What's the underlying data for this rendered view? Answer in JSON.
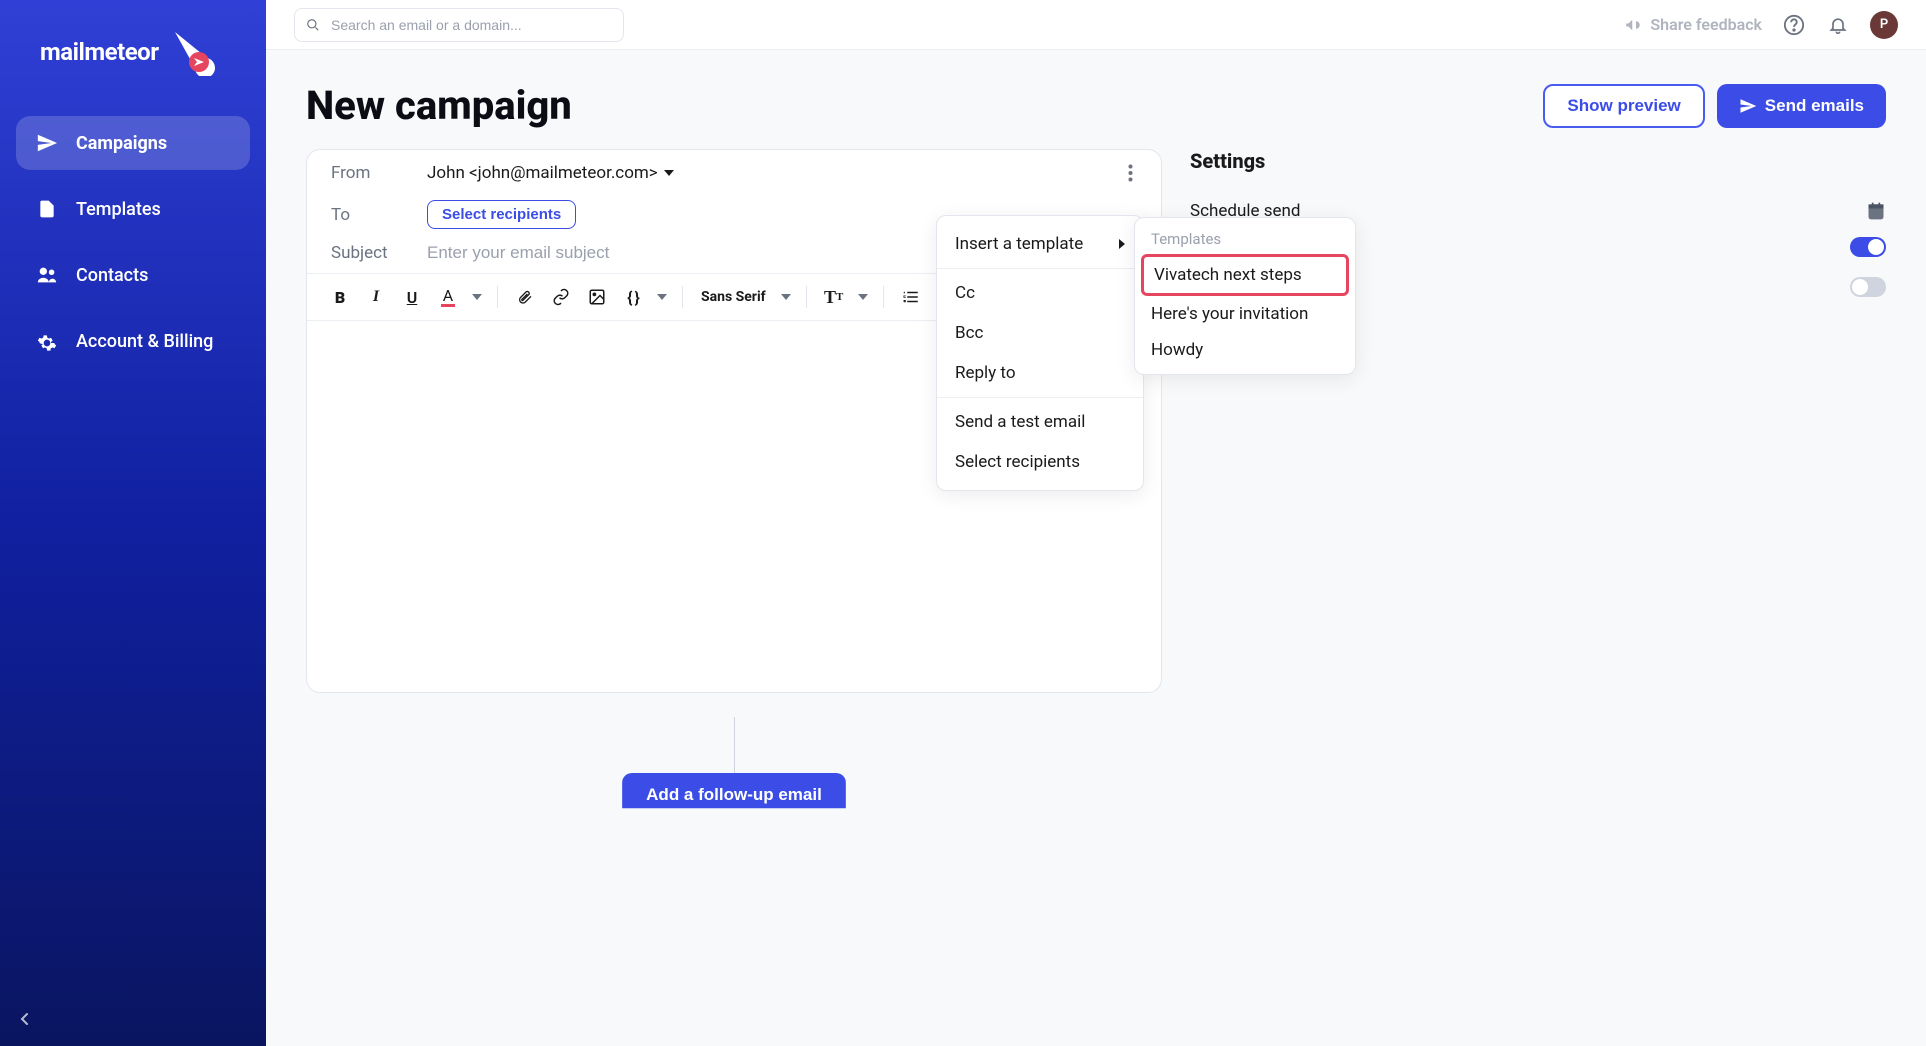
{
  "brand": {
    "name": "mailmeteor"
  },
  "sidebar": {
    "items": [
      {
        "label": "Campaigns",
        "icon": "send"
      },
      {
        "label": "Templates",
        "icon": "file"
      },
      {
        "label": "Contacts",
        "icon": "people"
      },
      {
        "label": "Account & Billing",
        "icon": "gear"
      }
    ]
  },
  "topbar": {
    "search_placeholder": "Search an email or a domain...",
    "feedback_label": "Share feedback",
    "avatar_initial": "P"
  },
  "page": {
    "title": "New campaign",
    "show_preview_label": "Show preview",
    "send_emails_label": "Send emails"
  },
  "compose": {
    "from_label": "From",
    "from_value": "John <john@mailmeteor.com>",
    "to_label": "To",
    "select_recipients_label": "Select recipients",
    "subject_label": "Subject",
    "subject_placeholder": "Enter your email subject",
    "font_name": "Sans Serif"
  },
  "more_menu": {
    "insert_template": "Insert a template",
    "cc": "Cc",
    "bcc": "Bcc",
    "reply_to": "Reply to",
    "send_test": "Send a test email",
    "select_recipients": "Select recipients"
  },
  "templates_menu": {
    "header": "Templates",
    "items": [
      "Vivatech next steps",
      "Here's your invitation",
      "Howdy"
    ]
  },
  "settings": {
    "title": "Settings",
    "schedule_label": "Schedule send",
    "autopilot_on": true,
    "tracking_on": false
  },
  "followup": {
    "label": "Add a follow-up email"
  }
}
